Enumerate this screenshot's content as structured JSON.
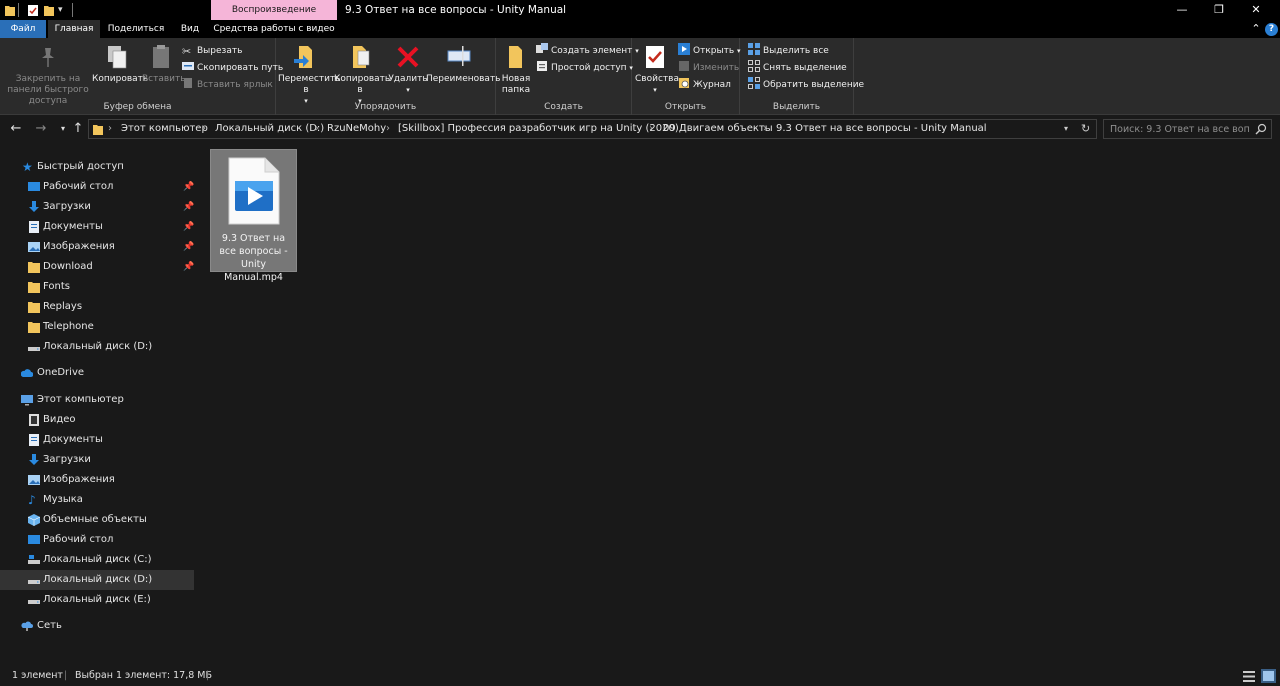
{
  "titlebar": {
    "context_tab": "Воспроизведение",
    "title": "9.3 Ответ на все вопросы - Unity Manual",
    "minimize_glyph": "—",
    "maximize_glyph": "❐",
    "close_glyph": "✕"
  },
  "tabs": {
    "file": "Файл",
    "home": "Главная",
    "share": "Поделиться",
    "view": "Вид",
    "video_tools": "Средства работы с видео"
  },
  "ribbon": {
    "clipboard": {
      "label": "Буфер обмена",
      "pin": "Закрепить на панели быстрого доступа",
      "copy": "Копировать",
      "paste": "Вставить",
      "cut": "Вырезать",
      "copy_path": "Скопировать путь",
      "paste_shortcut": "Вставить ярлык"
    },
    "organize": {
      "label": "Упорядочить",
      "move_to": "Переместить в",
      "copy_to": "Копировать в",
      "delete": "Удалить",
      "rename": "Переименовать"
    },
    "create": {
      "label": "Создать",
      "new_folder": "Новая папка",
      "new_item": "Создать элемент",
      "easy_access": "Простой доступ"
    },
    "open": {
      "label": "Открыть",
      "properties": "Свойства",
      "open": "Открыть",
      "edit": "Изменить",
      "history": "Журнал"
    },
    "select": {
      "label": "Выделить",
      "select_all": "Выделить все",
      "select_none": "Снять выделение",
      "invert": "Обратить выделение"
    }
  },
  "address": {
    "crumbs": [
      "Этот компьютер",
      "Локальный диск (D:)",
      "RzuNeMohy",
      "[Skillbox] Профессия разработчик игр на Unity (2020)",
      "09 Двигаем объекты",
      "9.3 Ответ на все вопросы - Unity Manual"
    ],
    "search_placeholder": "Поиск: 9.3 Ответ на все вопр..."
  },
  "nav": {
    "quick_access": "Быстрый доступ",
    "quick_items": [
      "Рабочий стол",
      "Загрузки",
      "Документы",
      "Изображения",
      "Download",
      "Fonts",
      "Replays",
      "Telephone",
      "Локальный диск (D:)"
    ],
    "onedrive": "OneDrive",
    "this_pc": "Этот компьютер",
    "pc_items": [
      "Видео",
      "Документы",
      "Загрузки",
      "Изображения",
      "Музыка",
      "Объемные объекты",
      "Рабочий стол",
      "Локальный диск (C:)",
      "Локальный диск (D:)",
      "Локальный диск (E:)"
    ],
    "network": "Сеть"
  },
  "content": {
    "file_name": "9.3 Ответ на все вопросы - Unity Manual.mp4"
  },
  "status": {
    "count": "1 элемент",
    "selected": "Выбран 1 элемент: 17,8 МБ"
  },
  "colors": {
    "accent": "#2a6fb8",
    "context_tab": "#f5b5d8",
    "background": "#191919",
    "ribbon": "#2b2b2b"
  }
}
